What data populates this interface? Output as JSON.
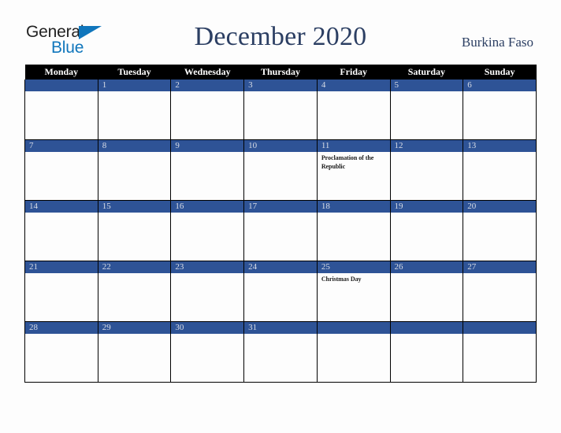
{
  "brand": {
    "line1": "General",
    "line2": "Blue",
    "triangle_icon": "triangle-icon",
    "color_dark": "#222222",
    "color_blue": "#1076bc"
  },
  "header": {
    "title": "December 2020",
    "country": "Burkina Faso",
    "title_color": "#2c3f63"
  },
  "calendar": {
    "weekday_headers": [
      "Monday",
      "Tuesday",
      "Wednesday",
      "Thursday",
      "Friday",
      "Saturday",
      "Sunday"
    ],
    "header_bg": "#000000",
    "header_text_color": "#ffffff",
    "day_bar_color": "#2e5396",
    "day_number_color": "#d9dde6",
    "cell_bg": "#fdfdfd",
    "grid_line_color": "#000000",
    "weeks": [
      [
        {
          "day": "",
          "events": []
        },
        {
          "day": "1",
          "events": []
        },
        {
          "day": "2",
          "events": []
        },
        {
          "day": "3",
          "events": []
        },
        {
          "day": "4",
          "events": []
        },
        {
          "day": "5",
          "events": []
        },
        {
          "day": "6",
          "events": []
        }
      ],
      [
        {
          "day": "7",
          "events": []
        },
        {
          "day": "8",
          "events": []
        },
        {
          "day": "9",
          "events": []
        },
        {
          "day": "10",
          "events": []
        },
        {
          "day": "11",
          "events": [
            "Proclamation of the Republic"
          ]
        },
        {
          "day": "12",
          "events": []
        },
        {
          "day": "13",
          "events": []
        }
      ],
      [
        {
          "day": "14",
          "events": []
        },
        {
          "day": "15",
          "events": []
        },
        {
          "day": "16",
          "events": []
        },
        {
          "day": "17",
          "events": []
        },
        {
          "day": "18",
          "events": []
        },
        {
          "day": "19",
          "events": []
        },
        {
          "day": "20",
          "events": []
        }
      ],
      [
        {
          "day": "21",
          "events": []
        },
        {
          "day": "22",
          "events": []
        },
        {
          "day": "23",
          "events": []
        },
        {
          "day": "24",
          "events": []
        },
        {
          "day": "25",
          "events": [
            "Christmas Day"
          ]
        },
        {
          "day": "26",
          "events": []
        },
        {
          "day": "27",
          "events": []
        }
      ],
      [
        {
          "day": "28",
          "events": []
        },
        {
          "day": "29",
          "events": []
        },
        {
          "day": "30",
          "events": []
        },
        {
          "day": "31",
          "events": []
        },
        {
          "day": "",
          "events": []
        },
        {
          "day": "",
          "events": []
        },
        {
          "day": "",
          "events": []
        }
      ]
    ]
  }
}
